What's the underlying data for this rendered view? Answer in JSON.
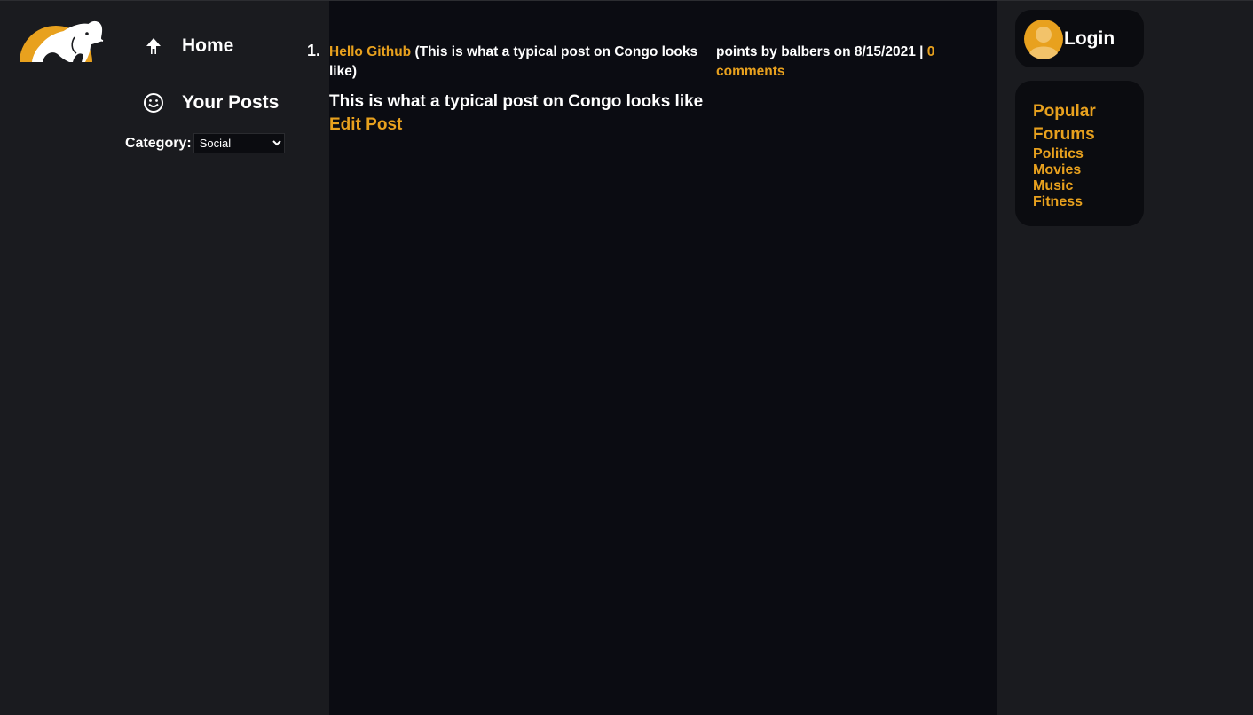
{
  "brand": {
    "logo_icon": "elephant-logo-icon",
    "accent_color": "#e8a11e"
  },
  "sidebar": {
    "items": [
      {
        "icon": "home-arrow-icon",
        "label": "Home"
      },
      {
        "icon": "smiley-icon",
        "label": "Your Posts"
      }
    ],
    "category": {
      "label": "Category:",
      "selected": "Social"
    }
  },
  "feed": {
    "posts": [
      {
        "index": "1.",
        "title": "Hello Github",
        "subtitle": "(This is what a typical post on Congo looks like)",
        "meta_prefix": "points by balbers on 8/15/2021 |",
        "comments": "0 comments",
        "body": "This is what a typical post on Congo looks like",
        "edit_label": "Edit Post"
      }
    ]
  },
  "account": {
    "icon": "user-avatar-icon",
    "login_label": "Login"
  },
  "forums": {
    "title": "Popular Forums",
    "items": [
      "Politics",
      "Movies",
      "Music",
      "Fitness"
    ]
  }
}
